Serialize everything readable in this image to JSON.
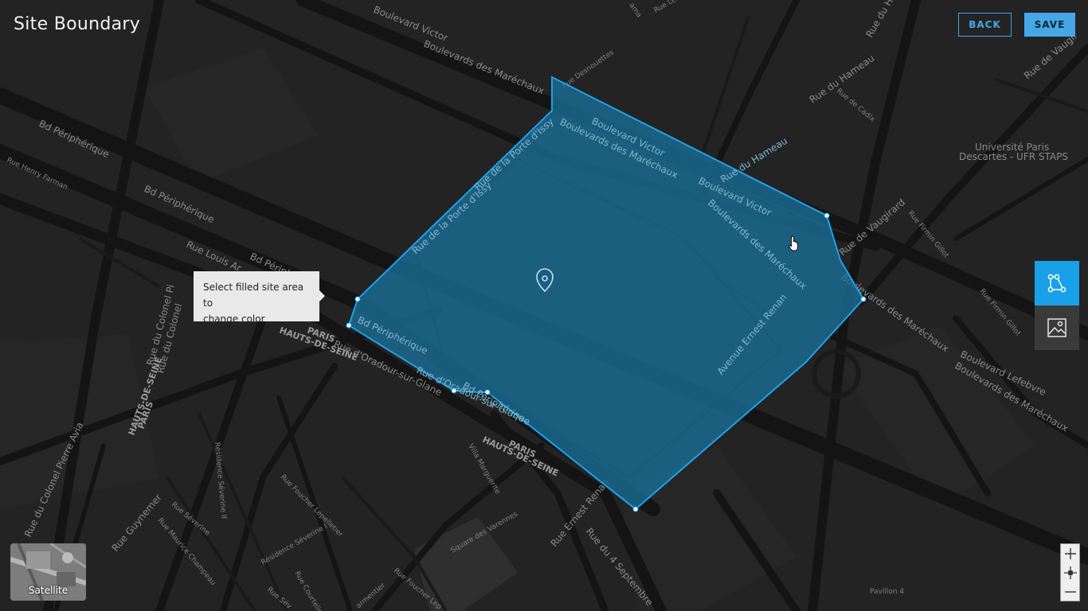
{
  "header": {
    "title": "Site Boundary",
    "back_label": "BACK",
    "save_label": "SAVE"
  },
  "tooltip": {
    "line1": "Select filled site area to",
    "line2": "change color"
  },
  "map": {
    "labels": {
      "boulevard_victor_top": "Boulevard Victor",
      "boulevards_marechaux_top": "Boulevards des Maréchaux",
      "rue_desnouettes": "Rue Desnouettes",
      "bd_peripherique_1": "Bd Périphérique",
      "bd_peripherique_2": "Bd Périphérique",
      "bd_peripherique_3": "Bd Périph",
      "rue_henry_farman": "Rue Henry Farman",
      "rue_louis_armand": "Rue Louis Ar",
      "rue_du_hameau_top": "Rue du Hameau",
      "rue_de_cadix": "Rue de Cadix",
      "universite_line1": "Université Paris",
      "universite_line2": "Descartes - UFR STAPS",
      "rue_de_vaugirard_tr": "Rue de Vaugir",
      "rue_de_vaugirard": "Rue de Vaugirard",
      "rue_firmin_gillot_1": "Rue Firmin Gillot",
      "rue_firmin_gillot_2": "Rue Firmin Gillot",
      "boulevards_marechaux_right": "Boulevards des Maréchaux",
      "boulevard_lefebvre": "Boulevard Lefebvre",
      "boulevards_marechaux_br": "Boulevards des Maréchaux",
      "paris_left_1": "PARIS",
      "paris_left_2": "HAUTS-DE-SEINE",
      "rue_colonel_pi_1": "Rue du Colonel Pi",
      "rue_colonel_pi_2": "Rue du Colonel",
      "paris_mid_1": "PARIS",
      "paris_mid_2": "HAUTS-DE-SEINE",
      "rue_oradour": "Rue d'Oradour-sur-Glane",
      "rue_colonel_pierre_avia": "Rue du Colonel Pierre Avia",
      "paris_bottom_1": "PARIS",
      "paris_bottom_2": "HAUTS-DE-SEINE",
      "residence_severine_2": "Résidence Séverine II",
      "rue_foucher_lepelletier": "Rue Foucher Lepelletier",
      "villa_marguerite": "Villa Marguerite",
      "rue_guynemer": "Rue Guynemer",
      "rue_severine": "Rue Séverine",
      "rue_maurice_champeau": "Rue Maurice Champeau",
      "residence_severine_1": "Résidence Séverine I",
      "rue_courteline": "Rue Courteline",
      "rue_sev": "Rue Sév",
      "rue_armentier": "armentier",
      "rue_foucher_lep_2": "Rue Foucher Lep",
      "square_varennes": "Square des Varennes",
      "rue_ernest_renan": "Rue Ernest Renan",
      "rue_4_septembre": "Rue du 4 Septembre",
      "pavillon_4": "Pavillon 4",
      "rue_top_1": "Rue Leb",
      "rue_top_2": "Rue du Ha",
      "rue_top_3": "Rue de Vaugir",
      "rue_top_4": "ama"
    },
    "polygon_labels": {
      "boulevard_victor_1": "Boulevard Victor",
      "boulevards_marechaux_1": "Boulevards des Maréchaux",
      "rue_porte_issy_1": "Rue de la Porte d'Issy",
      "rue_porte_issy_2": "Rue de la Porte d'Issy",
      "rue_du_hameau": "Rue du Hameau",
      "boulevard_victor_2": "Boulevard Victor",
      "boulevards_marechaux_2": "Boulevards des Maréchaux",
      "avenue_ernest_renan": "Avenue Ernest Renan",
      "bd_peripherique": "Bd Périphérique",
      "rue_oradour": "Rue d'Oradour-sur-Glane",
      "bd_peripherique_2": "Bd Périphérique"
    },
    "colors": {
      "background": "#232323",
      "road": "#141414",
      "polygon_fill": "#1b6f99",
      "polygon_stroke": "#1aa3ee",
      "accent": "#45a7e6"
    }
  },
  "map_controls": {
    "draw_tool_icon": "polygon-draw-icon",
    "image_tool_icon": "image-icon",
    "zoom_in_icon": "plus-icon",
    "locate_icon": "locate-icon",
    "zoom_out_icon": "minus-icon",
    "satellite_label": "Satellite"
  }
}
